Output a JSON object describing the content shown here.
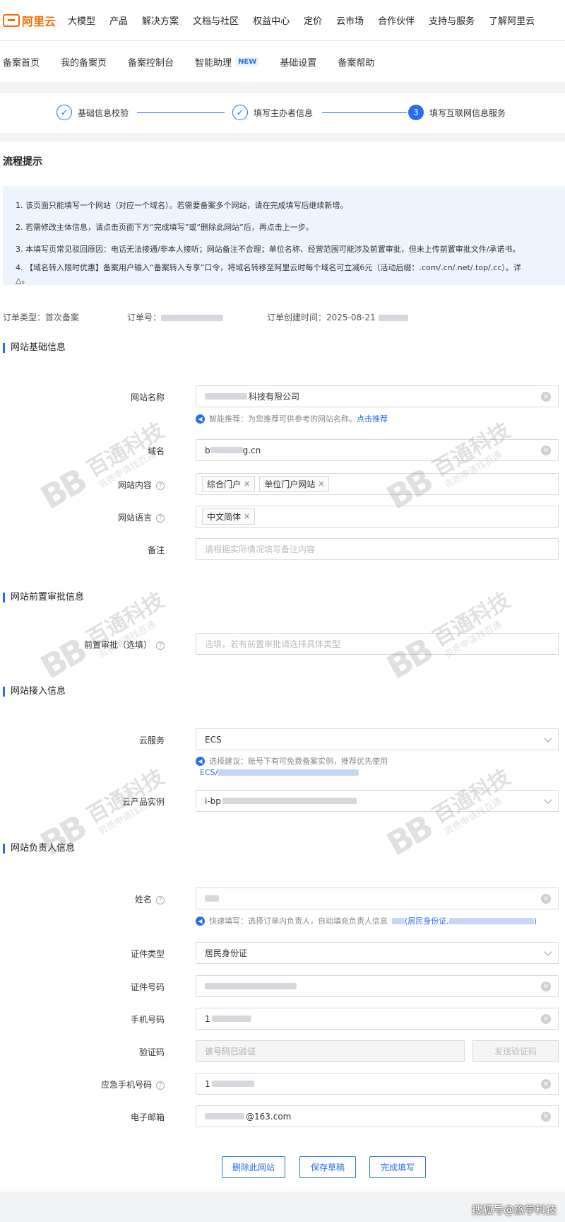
{
  "top_nav": {
    "logo_text": "阿里云",
    "items": [
      "大模型",
      "产品",
      "解决方案",
      "文档与社区",
      "权益中心",
      "定价",
      "云市场",
      "合作伙伴",
      "支持与服务",
      "了解阿里云"
    ]
  },
  "sub_nav": {
    "items": [
      "备案首页",
      "我的备案页",
      "备案控制台",
      "智能助理",
      "基础设置",
      "备案帮助"
    ],
    "new_badge": "NEW"
  },
  "steps": [
    {
      "label": "基础信息校验",
      "state": "done"
    },
    {
      "label": "填写主办者信息",
      "state": "done"
    },
    {
      "label": "填写互联网信息服务",
      "state": "active",
      "number": "3"
    }
  ],
  "process": {
    "title": "流程提示",
    "tips": [
      "1. 该页面只能填写一个网站（对应一个域名）。若需要备案多个网站，请在完成填写后继续新增。",
      "2. 若需修改主体信息，请点击页面下方“完成填写”或“删除此网站”后，再点击上一步。",
      "3. 本填写页常见驳回原因：电话无法接通/非本人接听；网站备注不合理；单位名称、经营范围可能涉及前置审批，但未上传前置审批文件/承诺书。",
      "4. 【域名转入限时优惠】备案用户输入“备案转入专享”口令，将域名转移至阿里云时每个域名可立减6元（活动后缀：.com/.cn/.net/.top/.cc）。详",
      "△。"
    ]
  },
  "order": {
    "type_label": "订单类型：",
    "type_value": "首次备案",
    "number_label": "订单号：",
    "created_label": "订单创建时间：",
    "created_value": "2025-08-21"
  },
  "sections": {
    "basic": "网站基础信息",
    "approval": "网站前置审批信息",
    "access": "网站接入信息",
    "owner": "网站负责人信息"
  },
  "basic": {
    "name_label": "网站名称",
    "name_value": "科技有限公司",
    "name_hint": "智能推荐：为您推荐可供参考的网站名称。",
    "name_hint_link": "点击推荐",
    "domain_label": "域名",
    "domain_value_prefix": "b",
    "domain_value_suffix": "g.cn",
    "content_label": "网站内容",
    "content_tags": [
      "综合门户",
      "单位门户网站"
    ],
    "language_label": "网站语言",
    "language_tags": [
      "中文简体"
    ],
    "remark_label": "备注",
    "remark_placeholder": "请根据实际情况填写备注内容"
  },
  "approval": {
    "label": "前置审批（选填）",
    "placeholder": "选填，若有前置审批请选择具体类型"
  },
  "access": {
    "cloud_label": "云服务",
    "cloud_value": "ECS",
    "cloud_hint": "选择建议：账号下有可免费备案实例，推荐优先使用",
    "cloud_hint_link": "ECS/",
    "instance_label": "云产品实例",
    "instance_value": "i-bp"
  },
  "owner": {
    "name_label": "姓名",
    "quick_hint": "快速填写：选择订单内负责人，自动填充负责人信息",
    "quick_hint_link_a": "(居民身份证,",
    "quick_hint_link_b": ")",
    "idtype_label": "证件类型",
    "idtype_value": "居民身份证",
    "idnum_label": "证件号码",
    "phone_label": "手机号码",
    "phone_value": "1",
    "code_label": "验证码",
    "code_placeholder": "该号码已验证",
    "code_button": "发送验证码",
    "emergency_label": "应急手机号码",
    "emergency_value": "1",
    "email_label": "电子邮箱",
    "email_value": "@163.com"
  },
  "buttons": {
    "delete": "删除此网站",
    "save": "保存草稿",
    "finish": "完成填写"
  },
  "watermark": {
    "title": "百通科技",
    "sub": "资质申请找百通",
    "logo": "BB"
  },
  "credit": "搜狐号@旅学科技"
}
